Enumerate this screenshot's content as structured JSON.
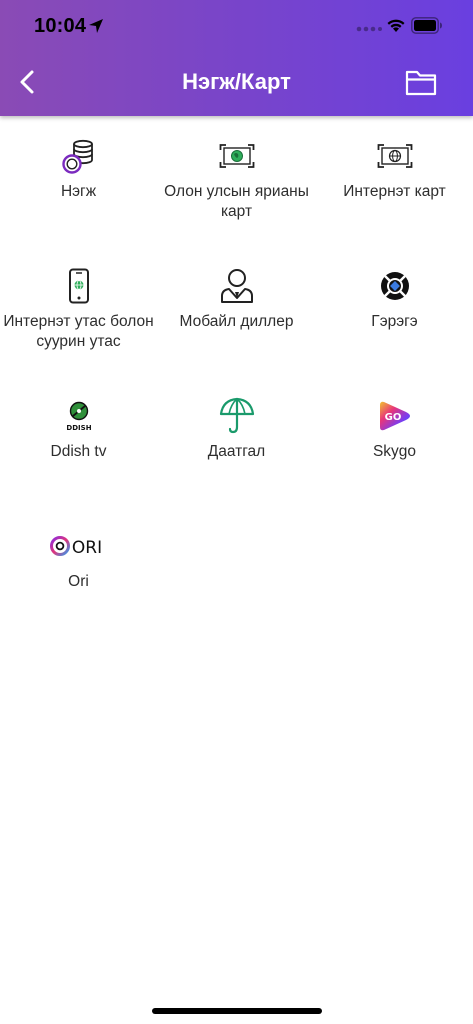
{
  "status_bar": {
    "time": "10:04"
  },
  "nav": {
    "title": "Нэгж/Карт"
  },
  "colors": {
    "header_start": "#8a4bb5",
    "header_end": "#6a3fe0",
    "label": "#2e2e2e"
  },
  "tiles": [
    {
      "label": "Нэгж",
      "icon": "coins-icon"
    },
    {
      "label": "Олон улсын ярианы карт",
      "icon": "intl-card-icon"
    },
    {
      "label": "Интернэт карт",
      "icon": "internet-card-icon"
    },
    {
      "label": "Интернэт утас болон суурин утас",
      "icon": "phone-icon"
    },
    {
      "label": "Мобайл диллер",
      "icon": "dealer-icon"
    },
    {
      "label": "Гэрэгэ",
      "icon": "gerege-icon"
    },
    {
      "label": "Ddish tv",
      "icon": "ddish-icon",
      "icon_text": "DDISH"
    },
    {
      "label": "Даатгал",
      "icon": "umbrella-icon"
    },
    {
      "label": "Skygo",
      "icon": "skygo-icon",
      "icon_text": "GO"
    },
    {
      "label": "Ori",
      "icon": "ori-icon",
      "icon_text": "ORI"
    }
  ]
}
